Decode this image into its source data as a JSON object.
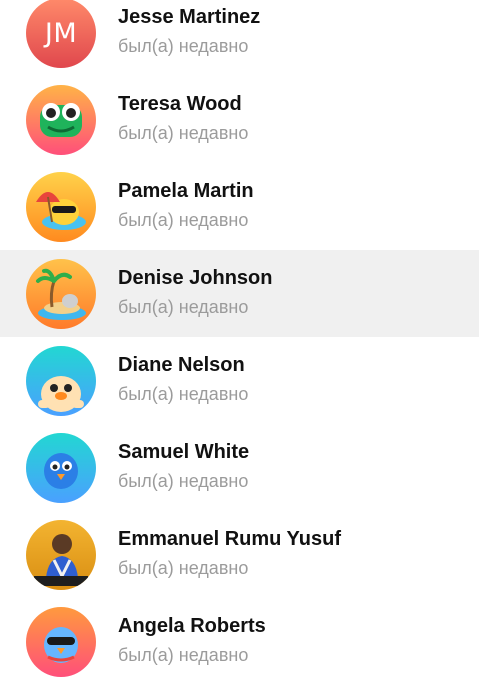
{
  "contacts": [
    {
      "name": "Jesse Martinez",
      "status": "был(а) недавно",
      "initials": "JM",
      "icon": "initials-avatar",
      "gradient": [
        "#ff8a6a",
        "#e0474d"
      ]
    },
    {
      "name": "Teresa Wood",
      "status": "был(а) недавно",
      "icon": "frog-sticker-icon",
      "gradient": [
        "#ffb347",
        "#ff4f7a"
      ]
    },
    {
      "name": "Pamela Martin",
      "status": "был(а) недавно",
      "icon": "duck-sunglasses-umbrella-icon",
      "gradient": [
        "#ffd24a",
        "#ff8a1f"
      ]
    },
    {
      "name": "Denise Johnson",
      "status": "был(а) недавно",
      "icon": "palm-island-duck-icon",
      "gradient": [
        "#ffc24a",
        "#ff7a2a"
      ],
      "active": true
    },
    {
      "name": "Diane Nelson",
      "status": "был(а) недавно",
      "icon": "duck-peeking-icon",
      "gradient": [
        "#22d7d2",
        "#4aa0ff"
      ]
    },
    {
      "name": "Samuel White",
      "status": "был(а) недавно",
      "icon": "blue-bird-icon",
      "gradient": [
        "#22d7d2",
        "#4aa0ff"
      ]
    },
    {
      "name": "Emmanuel Rumu Yusuf",
      "status": "был(а) недавно",
      "icon": "user-photo",
      "gradient": [
        "#f3b431",
        "#d98e12"
      ]
    },
    {
      "name": "Angela Roberts",
      "status": "был(а) недавно",
      "icon": "blue-bird-sunglasses-icon",
      "gradient": [
        "#ff9a3e",
        "#ff4f7a"
      ]
    }
  ]
}
